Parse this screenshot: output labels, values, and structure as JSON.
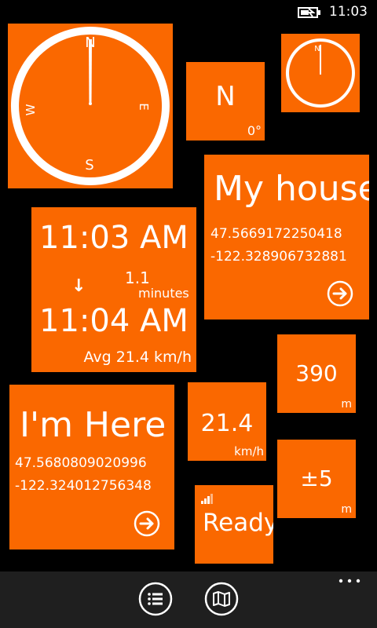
{
  "status_bar": {
    "time": "11:03",
    "battery_icon": "battery-charging-icon"
  },
  "compass_large": {
    "north": "N",
    "east": "E",
    "south": "S",
    "west": "W"
  },
  "compass_small": {
    "north": "N"
  },
  "heading": {
    "direction": "N",
    "degrees": "0°"
  },
  "my_house": {
    "title": "My house",
    "latitude": "47.5669172250418",
    "longitude": "-122.328906732881",
    "action_icon": "arrow-right-circle-icon"
  },
  "trip": {
    "start_time": "11:03 AM",
    "arrow_icon": "arrow-down-icon",
    "arrow_glyph": "↓",
    "duration_value": "1.1",
    "duration_unit": "minutes",
    "end_time": "11:04 AM",
    "average_speed": "Avg 21.4 km/h"
  },
  "distance": {
    "value": "390",
    "unit": "m"
  },
  "speed": {
    "value": "21.4",
    "unit": "km/h"
  },
  "im_here": {
    "title": "I'm Here",
    "latitude": "47.5680809020996",
    "longitude": "-122.324012756348",
    "action_icon": "arrow-right-circle-icon"
  },
  "accuracy": {
    "value": "±5",
    "unit": "m"
  },
  "gps": {
    "status": "Ready",
    "signal_icon": "signal-bars-icon"
  },
  "app_bar": {
    "list_icon": "list-icon",
    "map_icon": "map-icon",
    "more_icon": "more-ellipsis-icon"
  },
  "colors": {
    "accent": "#fa6800",
    "background": "#000000",
    "app_bar": "#1f1f1f"
  }
}
